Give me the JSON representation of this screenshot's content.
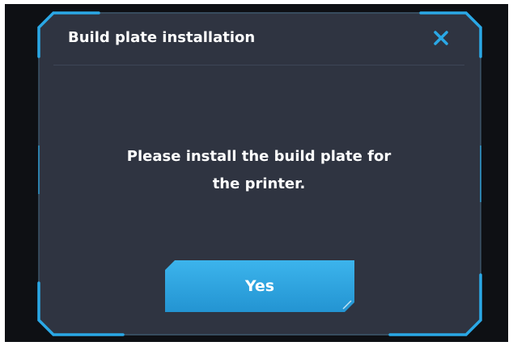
{
  "dialog": {
    "title": "Build plate installation",
    "message_line1": "Please install the build plate for",
    "message_line2": "the printer.",
    "confirm_label": "Yes",
    "close_icon": "close-icon"
  },
  "colors": {
    "accent": "#2aa8e6",
    "button": "#2da5e0",
    "dialog_bg": "#2f3441",
    "screen_bg": "#0e1014",
    "text": "#ffffff"
  }
}
